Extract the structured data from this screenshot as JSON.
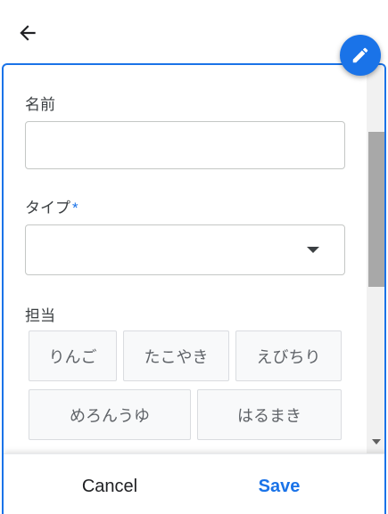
{
  "form": {
    "name_label": "名前",
    "name_value": "",
    "type_label": "タイプ",
    "type_required_mark": "*",
    "type_value": "",
    "assignee_label": "担当",
    "assignee_options": [
      "りんご",
      "たこやき",
      "えびちり",
      "めろんうゆ",
      "はるまき"
    ]
  },
  "footer": {
    "cancel_label": "Cancel",
    "save_label": "Save"
  },
  "icons": {
    "back": "arrow-left-icon",
    "edit": "pencil-icon",
    "select": "caret-down-icon"
  },
  "colors": {
    "accent": "#1a73e8"
  }
}
